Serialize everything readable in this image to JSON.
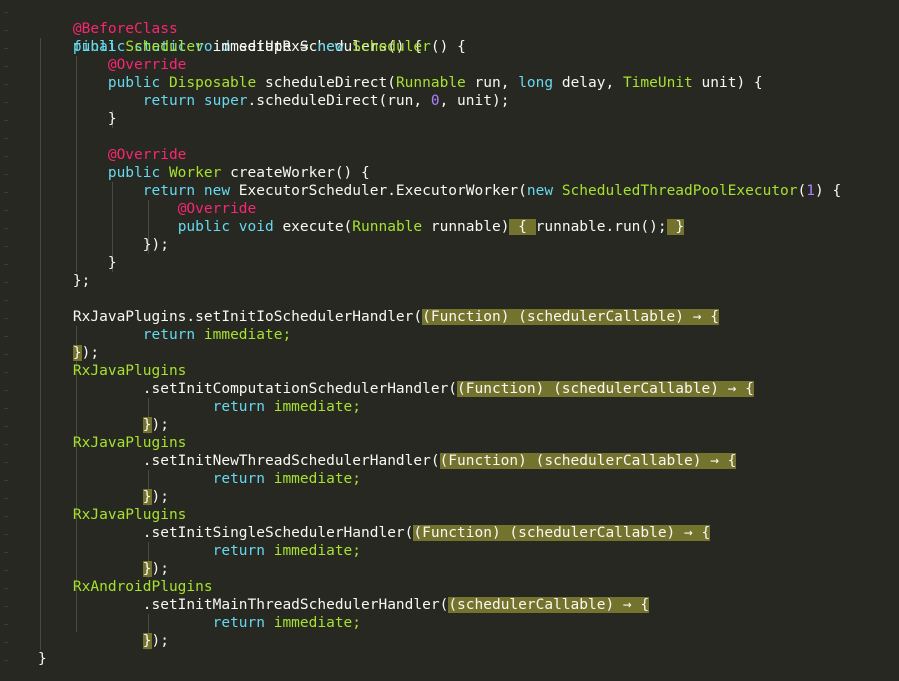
{
  "code": {
    "l1": {
      "ann": "@BeforeClass"
    },
    "l2": {
      "a": "public static void ",
      "b": "setUpRxSchedulers() {"
    },
    "l3": {
      "a": "final ",
      "b": "Scheduler",
      "c": " immediate = ",
      "d": "new ",
      "e": "Scheduler",
      "f": "() {"
    },
    "l4": {
      "ann": "@Override"
    },
    "l5": {
      "a": "public ",
      "b": "Disposable",
      "c": " scheduleDirect(",
      "d": "Runnable",
      "e": " run, ",
      "f": "long",
      "g": " delay, ",
      "h": "TimeUnit",
      "i": " unit) {"
    },
    "l6": {
      "a": "return super",
      "b": ".scheduleDirect(run, ",
      "c": "0",
      "d": ", unit);"
    },
    "l7": {
      "a": "}"
    },
    "l9": {
      "ann": "@Override"
    },
    "l10": {
      "a": "public ",
      "b": "Worker",
      "c": " createWorker() {"
    },
    "l11": {
      "a": "return new ",
      "b": "ExecutorScheduler.ExecutorWorker(",
      "c": "new ",
      "d": "ScheduledThreadPoolExecutor",
      "e": "(",
      "f": "1",
      "g": ") {"
    },
    "l12": {
      "ann": "@Override"
    },
    "l13": {
      "a": "public void ",
      "b": "execute(",
      "c": "Runnable",
      "d": " runnable)",
      "e": " { ",
      "f": "runnable.run();",
      "g": " }"
    },
    "l14": {
      "a": "});"
    },
    "l15": {
      "a": "}"
    },
    "l16": {
      "a": "};"
    },
    "l18": {
      "a": "RxJavaPlugins.setInitIoSchedulerHandler(",
      "h": "(Function) (schedulerCallable) → {"
    },
    "l19": {
      "a": "return ",
      "b": "immediate;"
    },
    "l20": {
      "h": "}",
      "a": ");"
    },
    "l21": {
      "a": "RxJavaPlugins"
    },
    "l22": {
      "a": ".setInitComputationSchedulerHandler(",
      "h": "(Function) (schedulerCallable) → {"
    },
    "l23": {
      "a": "return ",
      "b": "immediate;"
    },
    "l24": {
      "h": "}",
      "a": ");"
    },
    "l25": {
      "a": "RxJavaPlugins"
    },
    "l26": {
      "a": ".setInitNewThreadSchedulerHandler(",
      "h": "(Function) (schedulerCallable) → {"
    },
    "l27": {
      "a": "return ",
      "b": "immediate;"
    },
    "l28": {
      "h": "}",
      "a": ");"
    },
    "l29": {
      "a": "RxJavaPlugins"
    },
    "l30": {
      "a": ".setInitSingleSchedulerHandler(",
      "h": "(Function) (schedulerCallable) → {"
    },
    "l31": {
      "a": "return ",
      "b": "immediate;"
    },
    "l32": {
      "h": "}",
      "a": ");"
    },
    "l33": {
      "a": "RxAndroidPlugins"
    },
    "l34": {
      "a": ".setInitMainThreadSchedulerHandler(",
      "h": "(schedulerCallable) → {"
    },
    "l35": {
      "a": "return ",
      "b": "immediate;"
    },
    "l36": {
      "h": "}",
      "a": ");"
    },
    "l37": {
      "a": "}"
    }
  },
  "colors": {
    "background": "#272822",
    "annotation": "#f92672",
    "keyword": "#66d9ef",
    "type": "#a6e22e",
    "number": "#ae81ff",
    "highlight": "#74732e"
  }
}
